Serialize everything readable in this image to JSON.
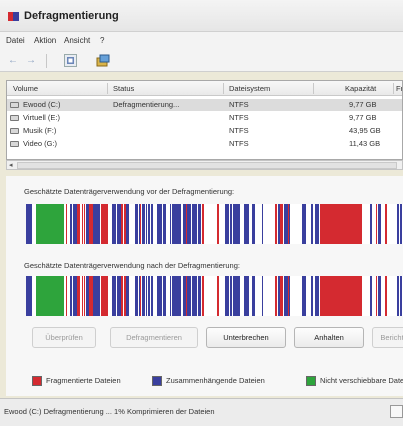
{
  "window": {
    "title": "Defragmentierung"
  },
  "menu": [
    "Datei",
    "Aktion",
    "Ansicht",
    "?"
  ],
  "toolbar": [
    {
      "icon": "back-arrow-icon",
      "glyph": "←"
    },
    {
      "icon": "forward-arrow-icon",
      "glyph": "→"
    },
    {
      "icon": "properties-icon",
      "glyph": ""
    },
    {
      "icon": "help-icon",
      "glyph": ""
    }
  ],
  "volumes": {
    "columns": [
      "Volume",
      "Status",
      "Dateisystem",
      "Kapazität",
      "Fr"
    ],
    "rows": [
      {
        "volume": "Ewood (C:)",
        "status": "Defragmentierung...",
        "fs": "NTFS",
        "capacity": "9,77 GB",
        "selected": true
      },
      {
        "volume": "Virtuell (E:)",
        "status": "",
        "fs": "NTFS",
        "capacity": "9,77 GB",
        "selected": false
      },
      {
        "volume": "Musik (F:)",
        "status": "",
        "fs": "NTFS",
        "capacity": "43,95 GB",
        "selected": false
      },
      {
        "volume": "Video (G:)",
        "status": "",
        "fs": "NTFS",
        "capacity": "11,43 GB",
        "selected": false
      }
    ]
  },
  "analysis": {
    "before_label": "Geschätzte Datenträgerverwendung vor der Defragmentierung:",
    "after_label": "Geschätzte Datenträgerverwendung nach der Defragmentierung:"
  },
  "buttons": [
    {
      "label": "Überprüfen",
      "enabled": false
    },
    {
      "label": "Defragmentieren",
      "enabled": false
    },
    {
      "label": "Unterbrechen",
      "enabled": true
    },
    {
      "label": "Anhalten",
      "enabled": true
    },
    {
      "label": "Bericht",
      "enabled": false
    }
  ],
  "legend": [
    {
      "label": "Fragmentierte Dateien",
      "color": "#d42a30"
    },
    {
      "label": "Zusammenhängende Dateien",
      "color": "#3a3f9e"
    },
    {
      "label": "Nicht verschiebbare Dateien",
      "color": "#2ea43c"
    }
  ],
  "colors": {
    "fragmented": "#d42a30",
    "contiguous": "#3a3f9e",
    "unmovable": "#2ea43c",
    "free": "#ffffff"
  },
  "status": {
    "text": "Ewood (C:) Defragmentierung ... 1% Komprimieren der Dateien"
  }
}
